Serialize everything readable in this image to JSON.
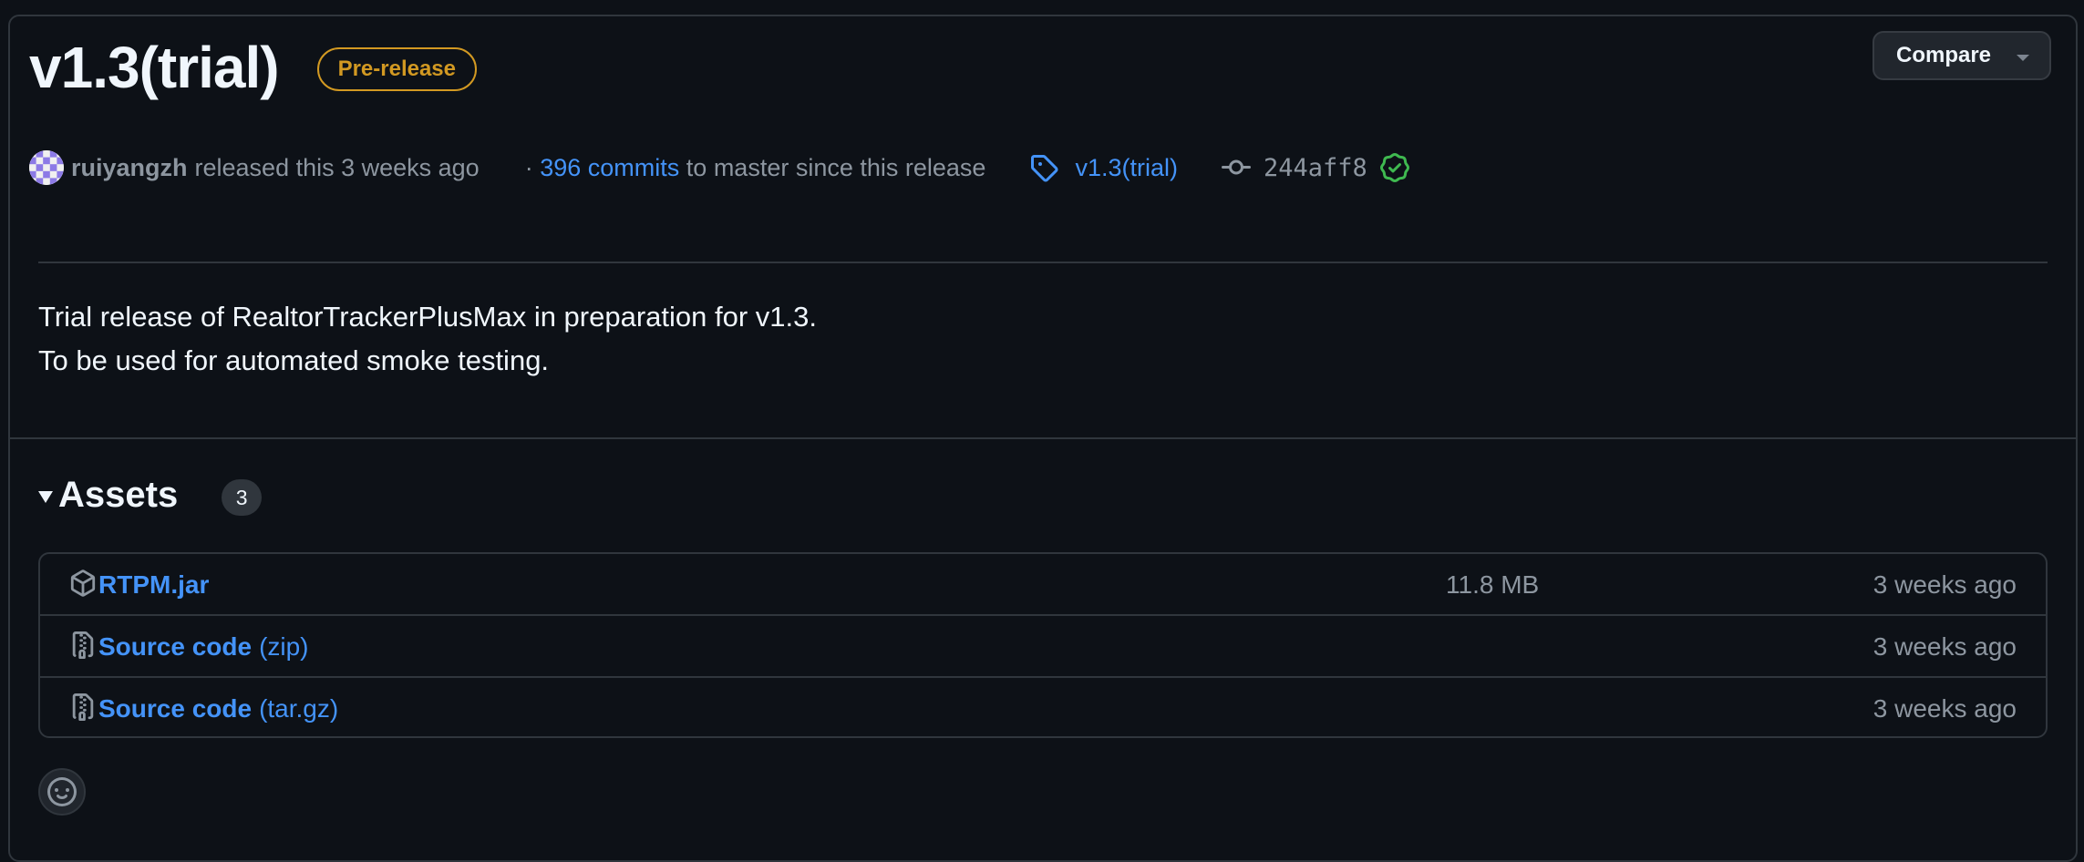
{
  "release": {
    "title": "v1.3(trial)",
    "badge": "Pre-release",
    "compare_label": "Compare"
  },
  "meta": {
    "author": "ruiyangzh",
    "released_text": "released this 3 weeks ago",
    "separator": "·",
    "commits_link": "396 commits",
    "commits_suffix": "to master since this release",
    "tag": "v1.3(trial)",
    "commit_sha": "244aff8"
  },
  "notes": {
    "line1": "Trial release of RealtorTrackerPlusMax in preparation for v1.3.",
    "line2": "To be used for automated smoke testing."
  },
  "assets": {
    "title": "Assets",
    "count": "3",
    "items": [
      {
        "name": "RTPM.jar",
        "suffix": "",
        "size": "11.8 MB",
        "time": "3 weeks ago",
        "icon": "package-icon"
      },
      {
        "name": "Source code",
        "suffix": "(zip)",
        "size": "",
        "time": "3 weeks ago",
        "icon": "file-zip-icon"
      },
      {
        "name": "Source code",
        "suffix": "(tar.gz)",
        "size": "",
        "time": "3 weeks ago",
        "icon": "file-zip-icon"
      }
    ]
  },
  "colors": {
    "background": "#0d1117",
    "border": "#30363d",
    "link": "#4493f8",
    "prerelease": "#d29922",
    "verified": "#3fb950",
    "muted": "#8d96a0"
  }
}
